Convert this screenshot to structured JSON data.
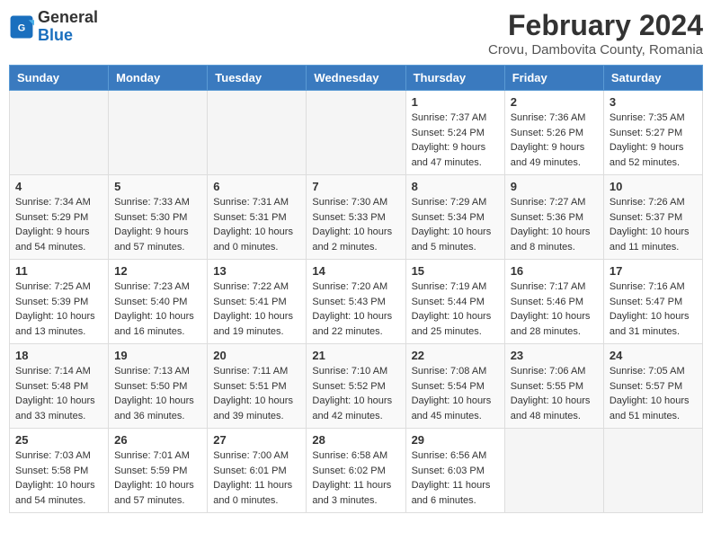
{
  "header": {
    "logo_general": "General",
    "logo_blue": "Blue",
    "month_title": "February 2024",
    "location": "Crovu, Dambovita County, Romania"
  },
  "days_of_week": [
    "Sunday",
    "Monday",
    "Tuesday",
    "Wednesday",
    "Thursday",
    "Friday",
    "Saturday"
  ],
  "weeks": [
    [
      {
        "day": "",
        "info": ""
      },
      {
        "day": "",
        "info": ""
      },
      {
        "day": "",
        "info": ""
      },
      {
        "day": "",
        "info": ""
      },
      {
        "day": "1",
        "info": "Sunrise: 7:37 AM\nSunset: 5:24 PM\nDaylight: 9 hours and 47 minutes."
      },
      {
        "day": "2",
        "info": "Sunrise: 7:36 AM\nSunset: 5:26 PM\nDaylight: 9 hours and 49 minutes."
      },
      {
        "day": "3",
        "info": "Sunrise: 7:35 AM\nSunset: 5:27 PM\nDaylight: 9 hours and 52 minutes."
      }
    ],
    [
      {
        "day": "4",
        "info": "Sunrise: 7:34 AM\nSunset: 5:29 PM\nDaylight: 9 hours and 54 minutes."
      },
      {
        "day": "5",
        "info": "Sunrise: 7:33 AM\nSunset: 5:30 PM\nDaylight: 9 hours and 57 minutes."
      },
      {
        "day": "6",
        "info": "Sunrise: 7:31 AM\nSunset: 5:31 PM\nDaylight: 10 hours and 0 minutes."
      },
      {
        "day": "7",
        "info": "Sunrise: 7:30 AM\nSunset: 5:33 PM\nDaylight: 10 hours and 2 minutes."
      },
      {
        "day": "8",
        "info": "Sunrise: 7:29 AM\nSunset: 5:34 PM\nDaylight: 10 hours and 5 minutes."
      },
      {
        "day": "9",
        "info": "Sunrise: 7:27 AM\nSunset: 5:36 PM\nDaylight: 10 hours and 8 minutes."
      },
      {
        "day": "10",
        "info": "Sunrise: 7:26 AM\nSunset: 5:37 PM\nDaylight: 10 hours and 11 minutes."
      }
    ],
    [
      {
        "day": "11",
        "info": "Sunrise: 7:25 AM\nSunset: 5:39 PM\nDaylight: 10 hours and 13 minutes."
      },
      {
        "day": "12",
        "info": "Sunrise: 7:23 AM\nSunset: 5:40 PM\nDaylight: 10 hours and 16 minutes."
      },
      {
        "day": "13",
        "info": "Sunrise: 7:22 AM\nSunset: 5:41 PM\nDaylight: 10 hours and 19 minutes."
      },
      {
        "day": "14",
        "info": "Sunrise: 7:20 AM\nSunset: 5:43 PM\nDaylight: 10 hours and 22 minutes."
      },
      {
        "day": "15",
        "info": "Sunrise: 7:19 AM\nSunset: 5:44 PM\nDaylight: 10 hours and 25 minutes."
      },
      {
        "day": "16",
        "info": "Sunrise: 7:17 AM\nSunset: 5:46 PM\nDaylight: 10 hours and 28 minutes."
      },
      {
        "day": "17",
        "info": "Sunrise: 7:16 AM\nSunset: 5:47 PM\nDaylight: 10 hours and 31 minutes."
      }
    ],
    [
      {
        "day": "18",
        "info": "Sunrise: 7:14 AM\nSunset: 5:48 PM\nDaylight: 10 hours and 33 minutes."
      },
      {
        "day": "19",
        "info": "Sunrise: 7:13 AM\nSunset: 5:50 PM\nDaylight: 10 hours and 36 minutes."
      },
      {
        "day": "20",
        "info": "Sunrise: 7:11 AM\nSunset: 5:51 PM\nDaylight: 10 hours and 39 minutes."
      },
      {
        "day": "21",
        "info": "Sunrise: 7:10 AM\nSunset: 5:52 PM\nDaylight: 10 hours and 42 minutes."
      },
      {
        "day": "22",
        "info": "Sunrise: 7:08 AM\nSunset: 5:54 PM\nDaylight: 10 hours and 45 minutes."
      },
      {
        "day": "23",
        "info": "Sunrise: 7:06 AM\nSunset: 5:55 PM\nDaylight: 10 hours and 48 minutes."
      },
      {
        "day": "24",
        "info": "Sunrise: 7:05 AM\nSunset: 5:57 PM\nDaylight: 10 hours and 51 minutes."
      }
    ],
    [
      {
        "day": "25",
        "info": "Sunrise: 7:03 AM\nSunset: 5:58 PM\nDaylight: 10 hours and 54 minutes."
      },
      {
        "day": "26",
        "info": "Sunrise: 7:01 AM\nSunset: 5:59 PM\nDaylight: 10 hours and 57 minutes."
      },
      {
        "day": "27",
        "info": "Sunrise: 7:00 AM\nSunset: 6:01 PM\nDaylight: 11 hours and 0 minutes."
      },
      {
        "day": "28",
        "info": "Sunrise: 6:58 AM\nSunset: 6:02 PM\nDaylight: 11 hours and 3 minutes."
      },
      {
        "day": "29",
        "info": "Sunrise: 6:56 AM\nSunset: 6:03 PM\nDaylight: 11 hours and 6 minutes."
      },
      {
        "day": "",
        "info": ""
      },
      {
        "day": "",
        "info": ""
      }
    ]
  ]
}
